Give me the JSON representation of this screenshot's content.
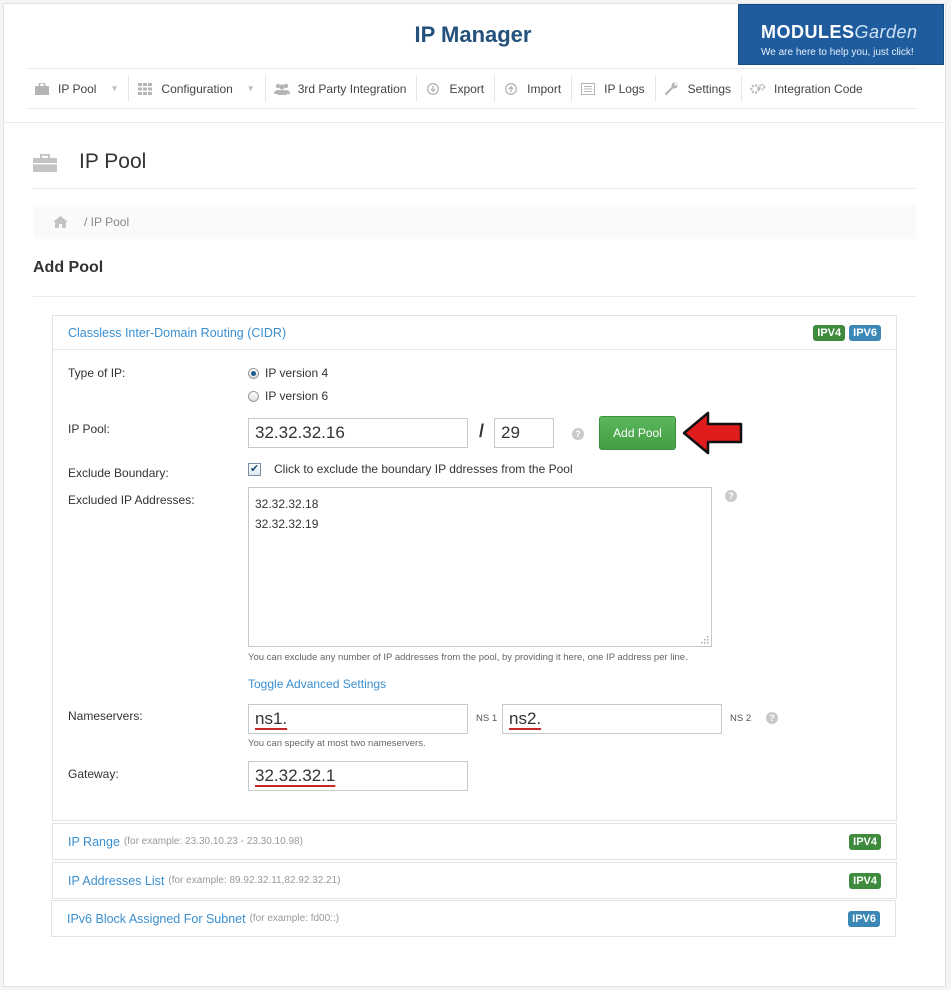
{
  "app": {
    "title": "IP Manager"
  },
  "brand": {
    "logo_main": "MODULES",
    "logo_sub": "Garden",
    "tagline": "We are here to help you, just click!"
  },
  "nav": [
    {
      "label": "IP Pool",
      "icon": "briefcase-icon",
      "dropdown": true
    },
    {
      "label": "Configuration",
      "icon": "grid-icon",
      "dropdown": true
    },
    {
      "label": "3rd Party Integration",
      "icon": "users-icon",
      "dropdown": false
    },
    {
      "label": "Export",
      "icon": "download-icon",
      "dropdown": false
    },
    {
      "label": "Import",
      "icon": "upload-icon",
      "dropdown": false
    },
    {
      "label": "IP Logs",
      "icon": "list-icon",
      "dropdown": false
    },
    {
      "label": "Settings",
      "icon": "wrench-icon",
      "dropdown": false
    },
    {
      "label": "Integration Code",
      "icon": "cogs-icon",
      "dropdown": false
    }
  ],
  "page": {
    "title": "IP Pool"
  },
  "breadcrumb": {
    "current": "/ IP Pool"
  },
  "section": {
    "title": "Add Pool"
  },
  "cidr": {
    "title": "Classless Inter-Domain Routing (CIDR)",
    "badges": [
      "IPV4",
      "IPV6"
    ],
    "type_label": "Type of IP:",
    "ipv4_label": "IP version 4",
    "ipv6_label": "IP version 6",
    "selected_version": "IP version 4",
    "pool_label": "IP Pool:",
    "pool_ip": "32.32.32.16",
    "slash": "/",
    "prefix": "29",
    "add_button": "Add Pool",
    "exclude_label": "Exclude Boundary:",
    "exclude_text": "Click to exclude the boundary IP ddresses from the Pool",
    "exclude_checked": true,
    "excluded_label": "Excluded IP Addresses:",
    "excluded_lines": [
      "32.32.32.18",
      "32.32.32.19"
    ],
    "excluded_note": "You can exclude any number of IP addresses from the pool, by providing it here, one IP address per line.",
    "toggle_advanced": "Toggle Advanced Settings",
    "nameservers_label": "Nameservers:",
    "ns1_value": "ns1.",
    "ns1_label": "NS 1",
    "ns2_value": "ns2.",
    "ns2_label": "NS 2",
    "ns_note": "You can specify at most two nameservers.",
    "gateway_label": "Gateway:",
    "gateway_value": "32.32.32.1",
    "help_glyph": "?"
  },
  "panels": [
    {
      "title": "IP Range",
      "hint": "(for example: 23.30.10.23 - 23.30.10.98)",
      "badge": "IPV4"
    },
    {
      "title": "IP Addresses List",
      "hint": "(for example: 89.92.32.11,82.92.32.21)",
      "badge": "IPV4"
    },
    {
      "title": "IPv6 Block Assigned For Subnet",
      "hint": "(for example: fd00::)",
      "badge": "IPV6"
    }
  ],
  "colors": {
    "accent": "#3a8fd0",
    "title": "#23517c",
    "ipv4": "#3e8b3e",
    "ipv6": "#3b87b5",
    "button": "#4cae4c",
    "arrow": "#e11c1c"
  }
}
